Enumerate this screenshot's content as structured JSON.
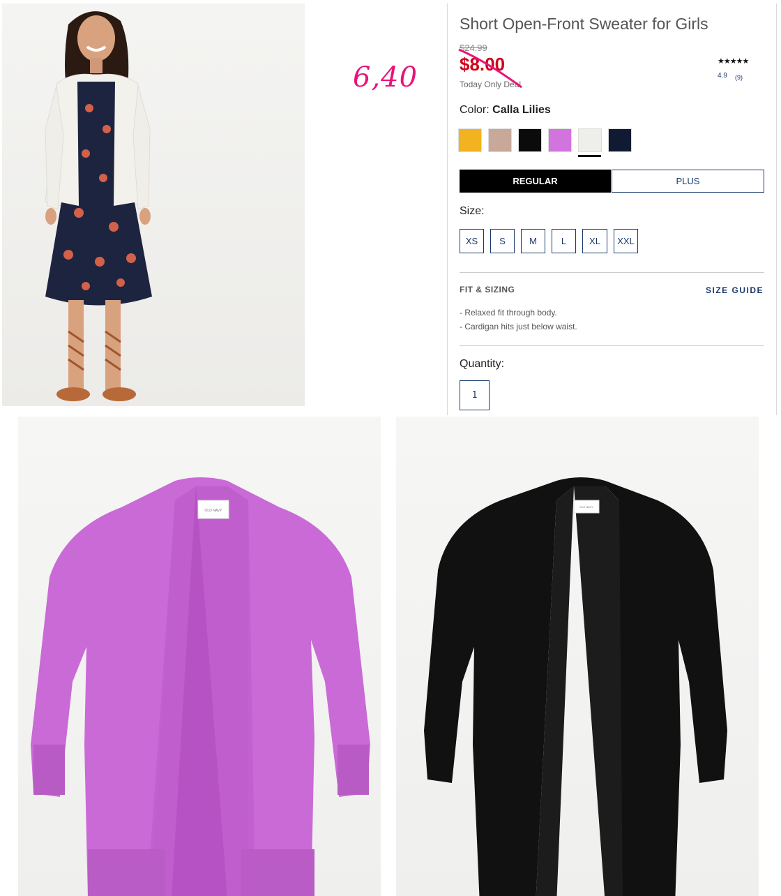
{
  "product": {
    "title": "Short Open-Front Sweater for Girls",
    "old_price": "$24.99",
    "sale_price": "$8.00",
    "deal_label": "Today Only Deal",
    "stars": "★★★★★",
    "rating": "4.9",
    "rating_count": "(9)"
  },
  "annotation": {
    "handwritten_price": "6,40"
  },
  "color": {
    "label": "Color:",
    "selected": "Calla Lilies",
    "swatches": [
      {
        "name": "yellow",
        "hex": "#f2b320"
      },
      {
        "name": "beige",
        "hex": "#c8a898"
      },
      {
        "name": "black",
        "hex": "#0b0b0b"
      },
      {
        "name": "purple",
        "hex": "#d274de"
      },
      {
        "name": "white",
        "hex": "#eeeeea"
      },
      {
        "name": "navy",
        "hex": "#111a33"
      }
    ]
  },
  "fit_type": {
    "regular": "REGULAR",
    "plus": "PLUS"
  },
  "size": {
    "label": "Size:",
    "options": [
      "XS",
      "S",
      "M",
      "L",
      "XL",
      "XXL"
    ]
  },
  "fit": {
    "title": "FIT & SIZING",
    "guide": "SIZE GUIDE",
    "items": [
      "-  Relaxed fit through body.",
      "-  Cardigan hits just below waist."
    ]
  },
  "quantity": {
    "label": "Quantity:",
    "value": "1"
  },
  "garment_labels": {
    "purple": "OLD NAVY",
    "black": "OLD NAVY"
  },
  "colors": {
    "accent_red": "#d0021b",
    "navy": "#1a3a6b",
    "annotation_pink": "#e8147a",
    "purple_cardigan": "#c86ad4",
    "black_cardigan": "#111111"
  }
}
